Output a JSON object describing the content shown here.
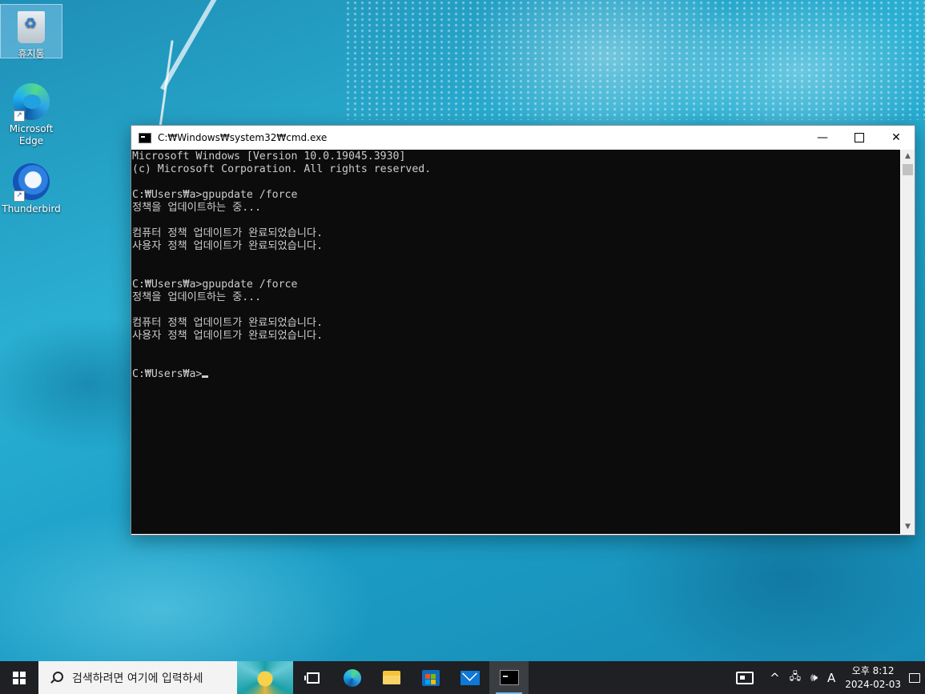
{
  "desktop": {
    "icons": [
      {
        "label": "휴지통",
        "icon": "recycle-bin-icon"
      },
      {
        "label": "Microsoft Edge",
        "label_line1": "Microsoft",
        "label_line2": "Edge",
        "icon": "edge-icon"
      },
      {
        "label": "Thunderbird",
        "icon": "thunderbird-icon"
      }
    ]
  },
  "window": {
    "title": "C:₩Windows₩system32₩cmd.exe",
    "controls": {
      "minimize": "—",
      "close": "✕"
    },
    "console_lines": [
      "Microsoft Windows [Version 10.0.19045.3930]",
      "(c) Microsoft Corporation. All rights reserved.",
      "",
      "C:₩Users₩a>gpupdate /force",
      "정책을 업데이트하는 중...",
      "",
      "컴퓨터 정책 업데이트가 완료되었습니다.",
      "사용자 정책 업데이트가 완료되었습니다.",
      "",
      "",
      "C:₩Users₩a>gpupdate /force",
      "정책을 업데이트하는 중...",
      "",
      "컴퓨터 정책 업데이트가 완료되었습니다.",
      "사용자 정책 업데이트가 완료되었습니다.",
      "",
      "",
      "C:₩Users₩a>"
    ],
    "scroll_up": "▲",
    "scroll_down": "▼",
    "colors": {
      "console_bg": "#0c0c0c",
      "console_fg": "#cccccc"
    }
  },
  "taskbar": {
    "search_placeholder": "검색하려면 여기에 입력하세",
    "pinned": [
      "task-view",
      "microsoft-edge",
      "file-explorer",
      "microsoft-store",
      "mail",
      "command-prompt"
    ],
    "tray": {
      "chevron": "^",
      "network": "🖧",
      "volume": "🕪",
      "ime": "A",
      "time_period": "오후 8:12",
      "date": "2024-02-03"
    },
    "colors": {
      "bg": "#1e2023",
      "active_indicator": "#76b9ed"
    }
  }
}
